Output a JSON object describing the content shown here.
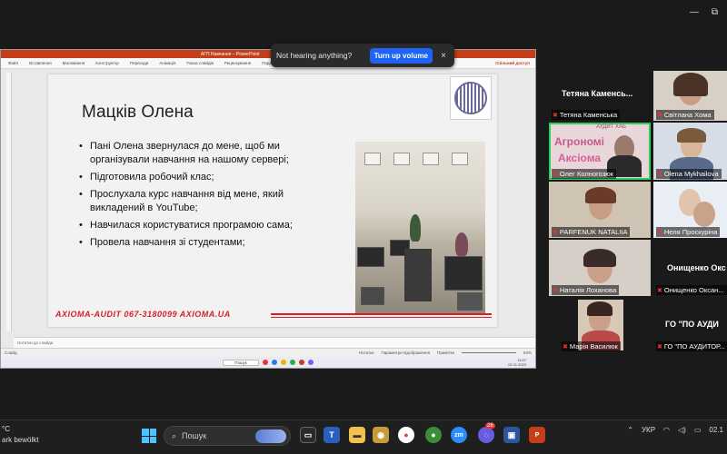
{
  "zoom": {
    "toast": {
      "message": "Not hearing anything?",
      "button": "Turn up volume",
      "close": "×"
    },
    "top_icons": [
      "minimize-icon",
      "fullscreen-icon"
    ]
  },
  "ppt": {
    "titlebar": {
      "filename": "АГП Навчання – PowerPoint",
      "search": "Пошук"
    },
    "ribbon": [
      "Файл",
      "Вставлення",
      "Малювання",
      "Конструктор",
      "Переходи",
      "Анімація",
      "Показ слайдів",
      "Рецензування",
      "Подання",
      "Запис"
    ],
    "share": "Спільний доступ",
    "slide": {
      "title": "Мацків Олена",
      "bullets": [
        "Пані Олена звернулася до мене, щоб ми організували навчання на нашому сервері;",
        "Підготовила робочий клас;",
        "Прослухала курс навчання від мене, який викладений в YouTube;",
        "Навчилася користуватися програмою сама;",
        "Провела навчання зі студентами;"
      ],
      "footer": "AXIOMA-AUDIT 067-3180099 AXIOMA.UA"
    },
    "notes": "Нотатки до слайда",
    "status": {
      "left": "Слайд",
      "notes_btn": "Нотатки",
      "display": "Параметри відображення",
      "comments": "Примітки",
      "zoom": "64%"
    },
    "inner_taskbar": {
      "search": "Пошук",
      "time": "11:07",
      "date": "02.11.2023"
    }
  },
  "participants": [
    {
      "name": "Тетяна Каменська",
      "big": "Тетяна  Каменсь...",
      "muted": true
    },
    {
      "name": "Світлана Хома",
      "muted": true
    },
    {
      "name": "Олег Колногозюк",
      "muted": true,
      "active": true
    },
    {
      "name": "Olena Mykhailova",
      "muted": true
    },
    {
      "name": "PARFENUK NATALIIA",
      "muted": true
    },
    {
      "name": "Неля Проскуріна",
      "muted": true
    },
    {
      "name": "Наталія Лоханова",
      "muted": true
    },
    {
      "name": "Онищенко Оксан...",
      "big": "Онищенко  Окс",
      "muted": true
    },
    {
      "name": "Марія Василюк",
      "muted": true
    },
    {
      "name": "ГО \"ПО АУДИТОР...",
      "big": "ГО  \"ПО  АУДИ",
      "muted": true
    }
  ],
  "tile_text": {
    "agro": "Агрономі",
    "axio": "Аксіома",
    "audit": "АУДИТ ХАБ"
  },
  "taskbar": {
    "weather_line1": "°C",
    "weather_line2": "ark bewölkt",
    "search": "Пошук",
    "lang": "УКР",
    "clock": "02.1",
    "badge": "26"
  }
}
